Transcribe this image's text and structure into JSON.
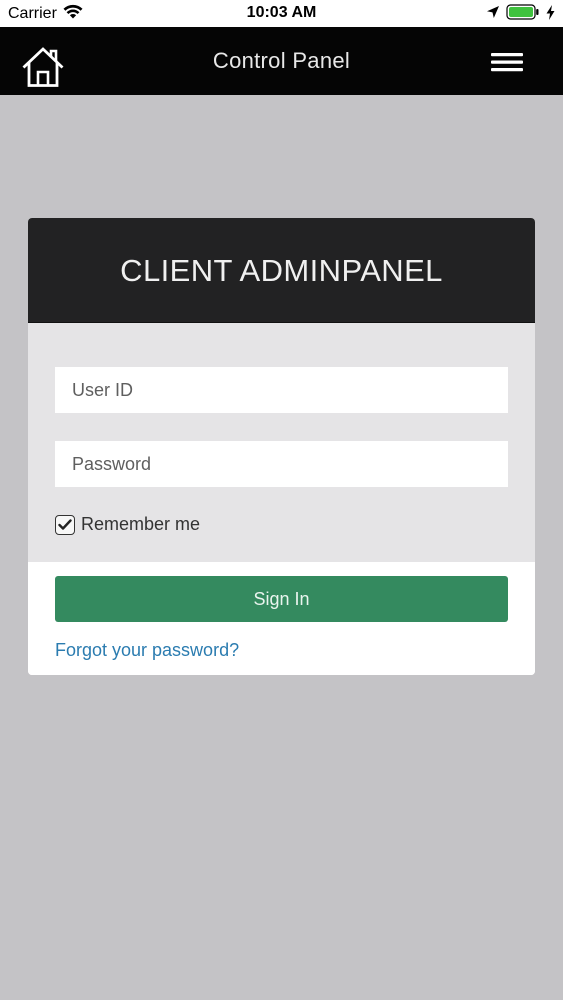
{
  "status_bar": {
    "carrier": "Carrier",
    "time": "10:03 AM",
    "icons": [
      "wifi-icon",
      "location-arrow-icon",
      "battery-icon",
      "charging-bolt-icon"
    ],
    "battery_color": "#3fc23e"
  },
  "nav": {
    "title": "Control Panel",
    "home_icon": "home-icon",
    "menu_icon": "hamburger-menu-icon"
  },
  "login": {
    "title": "CLIENT ADMINPANEL",
    "user_id_placeholder": "User ID",
    "password_placeholder": "Password",
    "remember_label": "Remember me",
    "remember_checked": true,
    "sign_in_label": "Sign In",
    "forgot_label": "Forgot your password?"
  },
  "colors": {
    "background": "#c4c3c6",
    "nav_background": "#050505",
    "card_header": "#222223",
    "form_background": "#e5e4e6",
    "accent_green": "#348a5f",
    "link_blue": "#2b7cb0"
  }
}
